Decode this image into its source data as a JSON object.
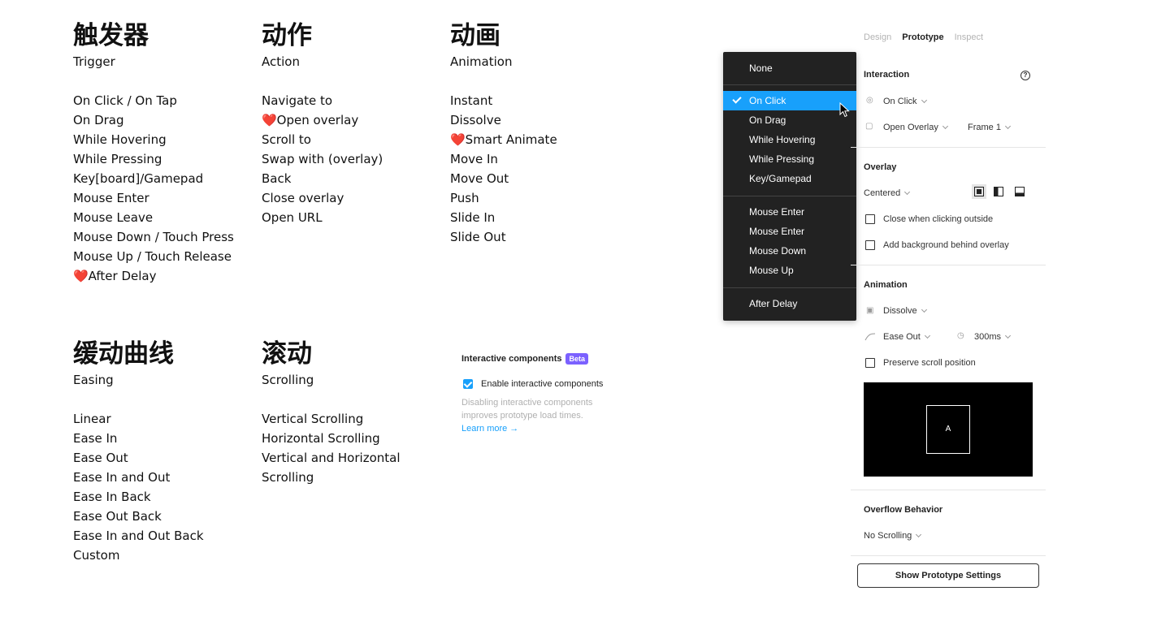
{
  "columns": {
    "trigger": {
      "zh": "触发器",
      "en": "Trigger",
      "items": [
        "On Click / On Tap",
        "On Drag",
        "While Hovering",
        "While Pressing",
        "Key[board]/Gamepad",
        "Mouse Enter",
        "Mouse Leave",
        "Mouse Down / Touch Press",
        "Mouse Up / Touch Release",
        "❤️After Delay"
      ]
    },
    "action": {
      "zh": "动作",
      "en": "Action",
      "items": [
        "Navigate to",
        "❤️Open overlay",
        "Scroll to",
        "Swap with (overlay)",
        "Back",
        "Close overlay",
        "Open URL"
      ]
    },
    "animation": {
      "zh": "动画",
      "en": "Animation",
      "items": [
        "Instant",
        "Dissolve",
        "❤️Smart Animate",
        "Move In",
        "Move Out",
        "Push",
        "Slide In",
        "Slide Out"
      ]
    },
    "easing": {
      "zh": "缓动曲线",
      "en": "Easing",
      "items": [
        "Linear",
        "Ease In",
        "Ease Out",
        "Ease In and Out",
        "Ease In Back",
        "Ease Out Back",
        "Ease In and Out Back",
        "Custom"
      ]
    },
    "scrolling": {
      "zh": "滚动",
      "en": "Scrolling",
      "items": [
        "Vertical Scrolling",
        "Horizontal Scrolling",
        "Vertical and Horizontal",
        "Scrolling"
      ]
    }
  },
  "interactive_components": {
    "title": "Interactive components",
    "badge": "Beta",
    "checkbox_label": "Enable interactive components",
    "checked": true,
    "description": "Disabling interactive components improves prototype load times.",
    "link": "Learn more →"
  },
  "dropdown": {
    "none": "None",
    "selected": "On Click",
    "group1": [
      "On Click",
      "On Drag",
      "While Hovering",
      "While Pressing",
      "Key/Gamepad"
    ],
    "group2": [
      "Mouse Enter",
      "Mouse Enter",
      "Mouse Down",
      "Mouse Up"
    ],
    "group3": [
      "After Delay"
    ]
  },
  "panel": {
    "tabs": [
      "Design",
      "Prototype",
      "Inspect"
    ],
    "active_tab": "Prototype",
    "interaction": {
      "header": "Interaction",
      "trigger": "On Click",
      "action": "Open Overlay",
      "destination": "Frame 1"
    },
    "overlay": {
      "header": "Overlay",
      "position": "Centered",
      "close_outside": "Close when clicking outside",
      "add_background": "Add background behind overlay"
    },
    "animation": {
      "header": "Animation",
      "type": "Dissolve",
      "easing": "Ease Out",
      "duration": "300ms",
      "preserve_scroll": "Preserve scroll position",
      "preview_label": "A"
    },
    "overflow": {
      "header": "Overflow Behavior",
      "value": "No Scrolling"
    },
    "settings_button": "Show Prototype Settings"
  },
  "colors": {
    "accent": "#18a0fb",
    "beta": "#7b61ff",
    "menu_bg": "#222222"
  }
}
